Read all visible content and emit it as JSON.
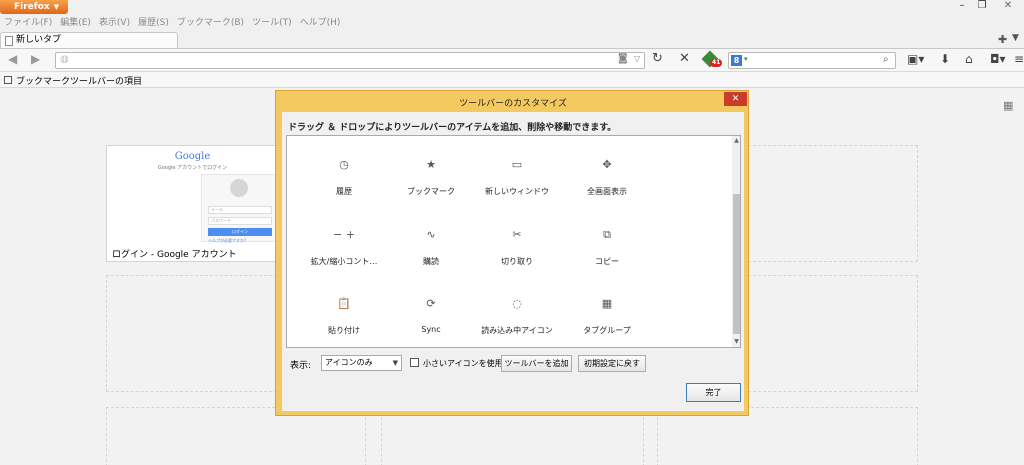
{
  "app": {
    "menu_button": "Firefox",
    "window_controls": {
      "minimize": "–",
      "maximize": "❐",
      "close": "✕"
    }
  },
  "menubar": [
    "ファイル(F)",
    "編集(E)",
    "表示(V)",
    "履歴(S)",
    "ブックマーク(B)",
    "ツール(T)",
    "ヘルプ(H)"
  ],
  "tabs": [
    {
      "label": "新しいタブ"
    }
  ],
  "navbar": {
    "url_value": "",
    "extension_badge": "41",
    "search_engine": "8",
    "search_value": ""
  },
  "bookmarks_bar": {
    "label": "ブックマークツールバーの項目"
  },
  "new_tab_page": {
    "tile": {
      "caption": "ログイン - Google アカウント",
      "thumb_logo": "Google",
      "thumb_subtitle": "Google アカウントでログイン",
      "thumb_field1": "メール",
      "thumb_field2": "パスワード",
      "thumb_button": "ログイン",
      "thumb_link": "ヘルプが必要ですか?"
    }
  },
  "dialog": {
    "title": "ツールバーのカスタマイズ",
    "close": "✕",
    "heading": "ドラッグ ＆ ドロップによりツールバーのアイテムを追加、削除や移動できます。",
    "items": [
      {
        "label": "履歴",
        "icon": "history-icon",
        "glyph": "◷"
      },
      {
        "label": "ブックマーク",
        "icon": "bookmark-icon",
        "glyph": "★"
      },
      {
        "label": "新しいウィンドウ",
        "icon": "new-window-icon",
        "glyph": "▭"
      },
      {
        "label": "全画面表示",
        "icon": "fullscreen-icon",
        "glyph": "✥"
      },
      {
        "label": "拡大/縮小コント…",
        "icon": "zoom-controls-icon",
        "glyph": "−   +"
      },
      {
        "label": "購読",
        "icon": "feed-icon",
        "glyph": "∿"
      },
      {
        "label": "切り取り",
        "icon": "cut-icon",
        "glyph": "✂"
      },
      {
        "label": "コピー",
        "icon": "copy-icon",
        "glyph": "⧉"
      },
      {
        "label": "貼り付け",
        "icon": "paste-icon",
        "glyph": "📋"
      },
      {
        "label": "Sync",
        "icon": "sync-icon",
        "glyph": "⟳"
      },
      {
        "label": "読み込み中アイコン",
        "icon": "throbber-icon",
        "glyph": "◌"
      },
      {
        "label": "タブグループ",
        "icon": "tab-groups-icon",
        "glyph": "▦"
      }
    ],
    "footer": {
      "show_label": "表示:",
      "show_value": "アイコンのみ",
      "small_icons_label": "小さいアイコンを使用",
      "add_toolbar": "ツールバーを追加",
      "restore_default": "初期設定に戻す",
      "done": "完了"
    }
  }
}
